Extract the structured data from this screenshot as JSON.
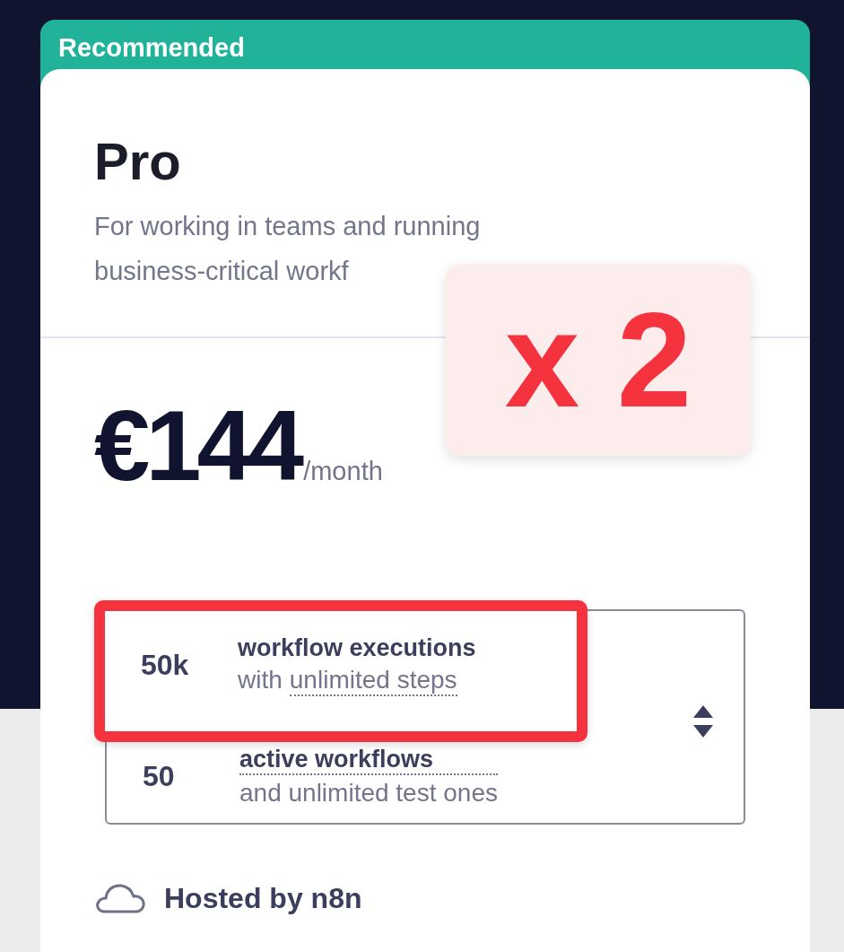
{
  "card": {
    "badge": "Recommended",
    "plan": "Pro",
    "description": "For working in teams and running business-critical workf",
    "price": "€144",
    "period": "/month",
    "quota_select": {
      "options": [
        {
          "amount": "50k",
          "title": "workflow executions",
          "title_dotted": false,
          "subtitle_lead": "with",
          "subtitle_term": "unlimited steps",
          "highlighted": true
        },
        {
          "amount": "50",
          "title": "active workflows",
          "title_dotted": true,
          "subtitle_lead": "and unlimited test ones",
          "highlighted": false
        }
      ]
    },
    "hosting": "Hosted by n8n"
  },
  "annotation": {
    "text": "x 2"
  }
}
